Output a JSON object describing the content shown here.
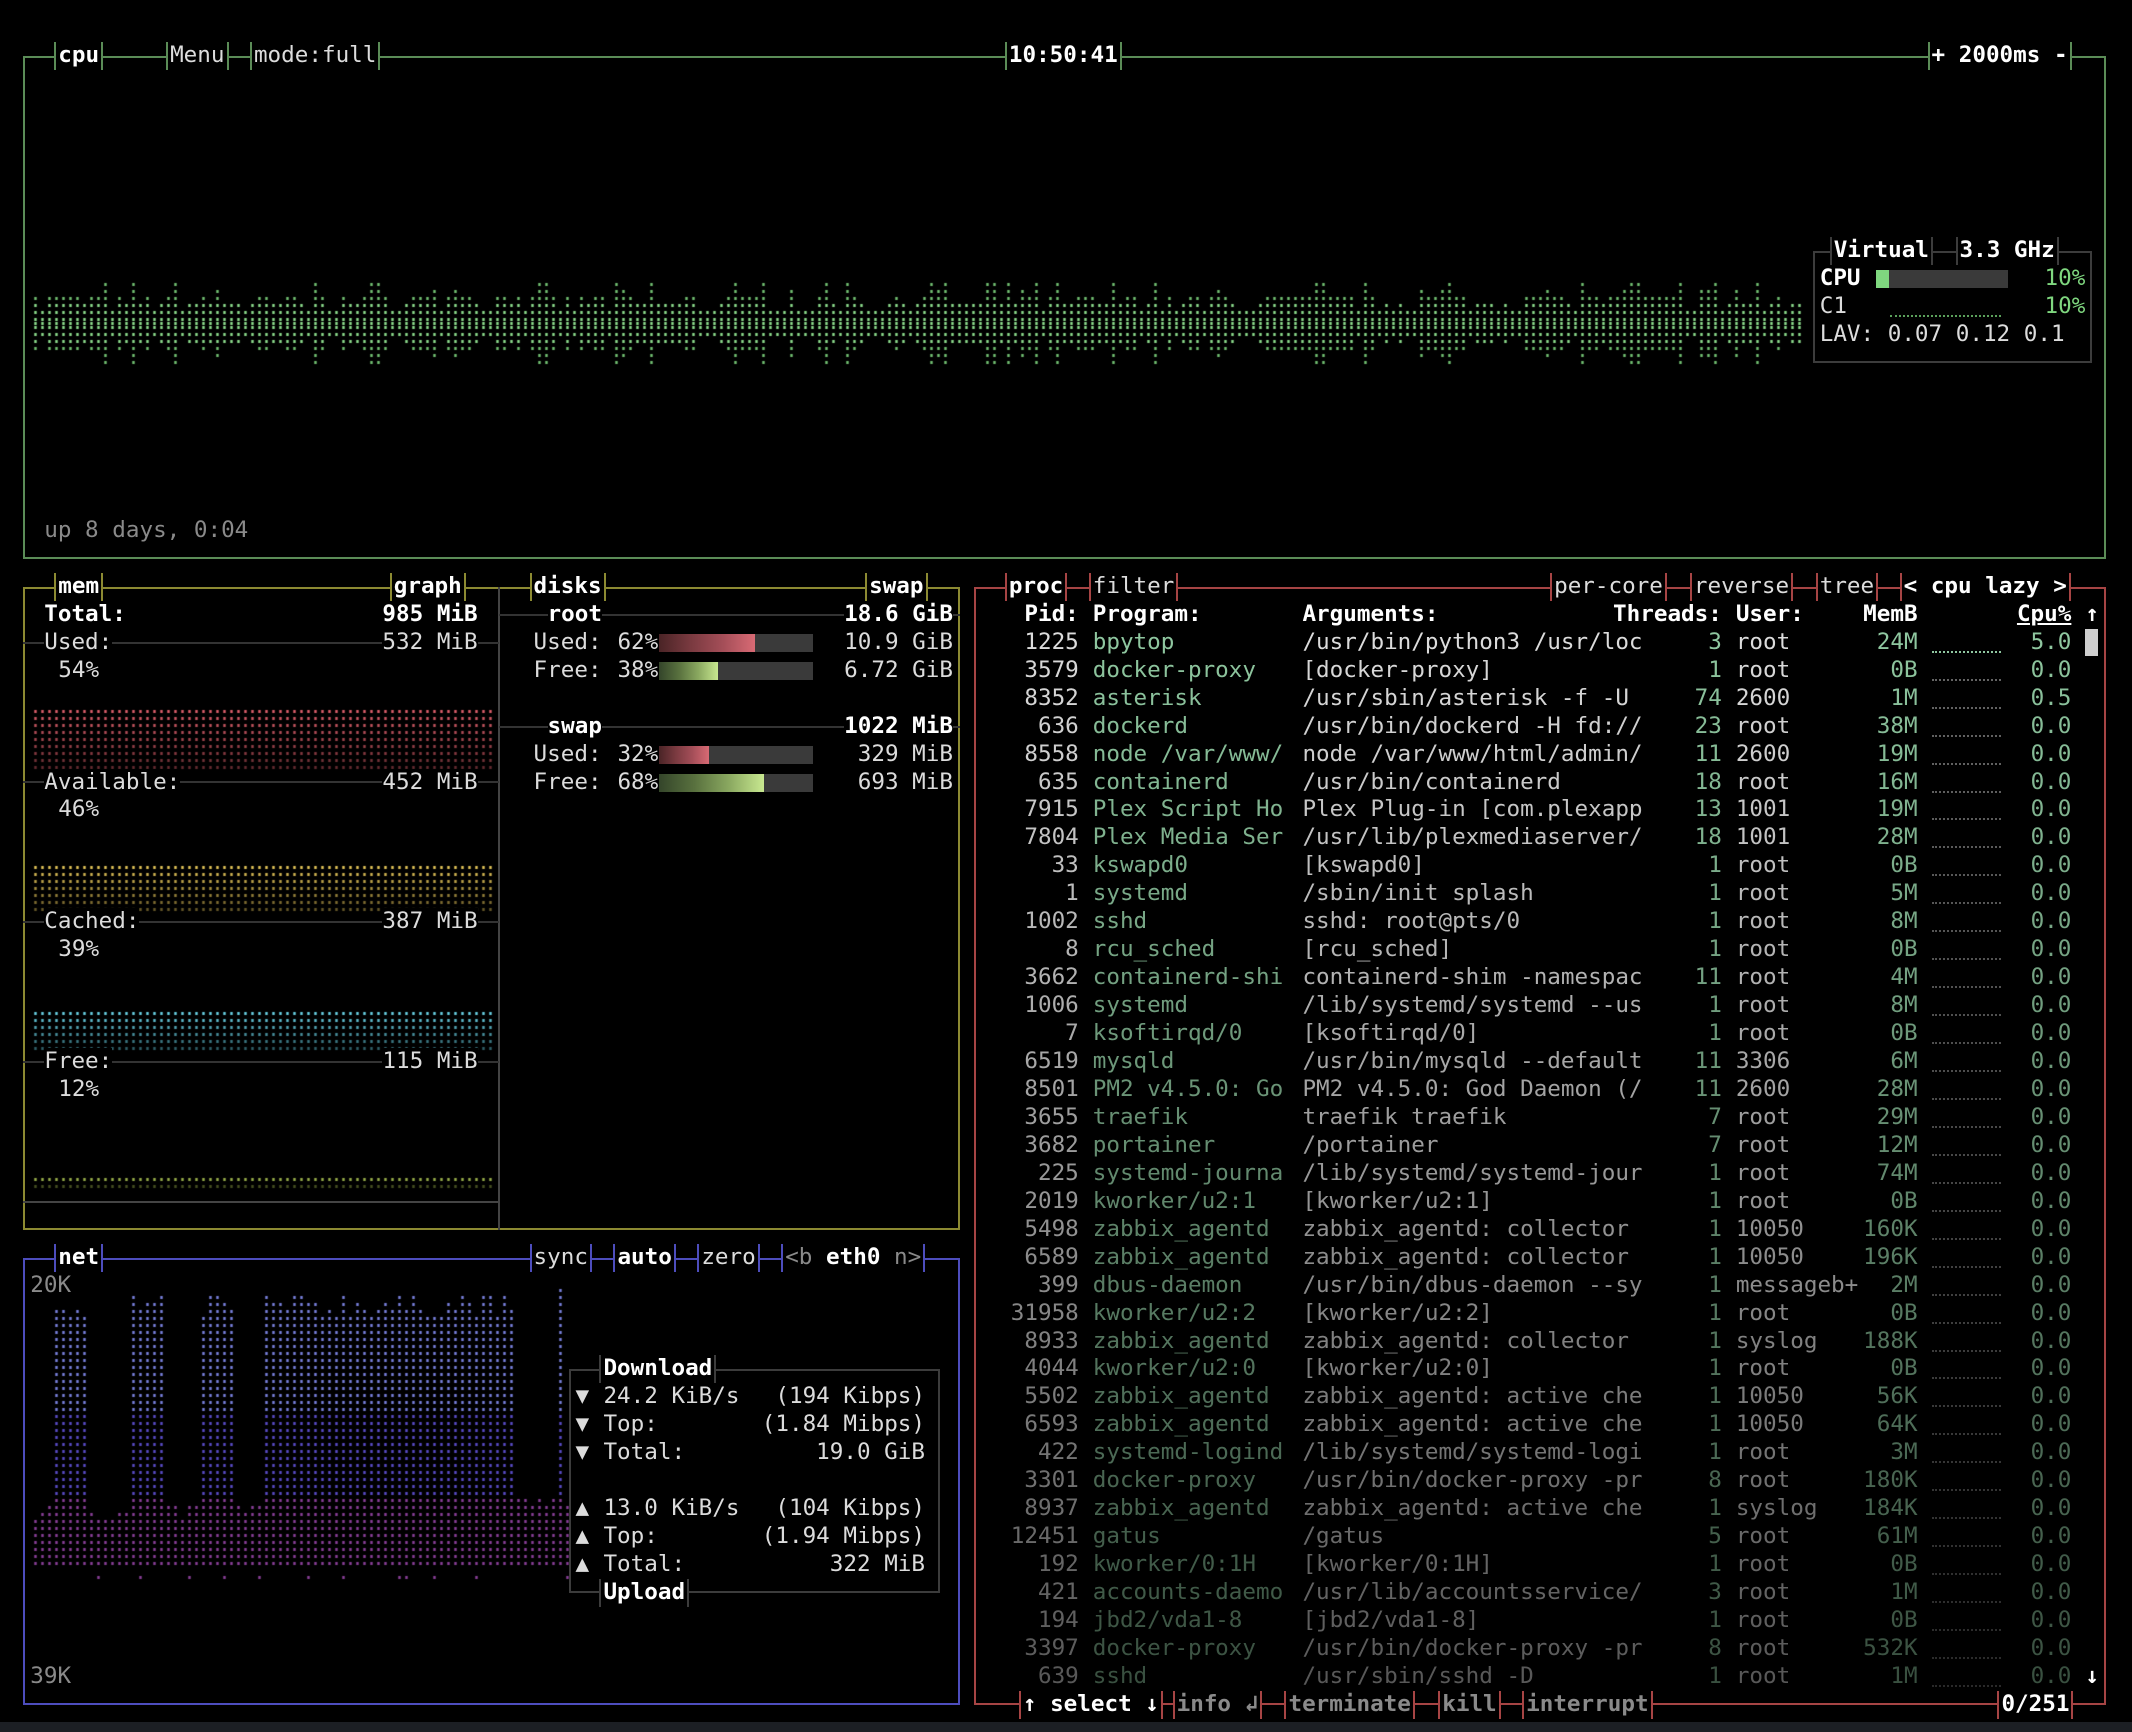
{
  "cpu": {
    "title": "cpu",
    "menu": "Menu",
    "mode": "mode:full",
    "clock": "10:50:41",
    "interval": "+ 2000ms -",
    "uptime": "up 8 days, 0:04",
    "info": {
      "name": "Virtual",
      "freq": "3.3 GHz",
      "cpu_label": "CPU",
      "cpu_pct": "10%",
      "core_label": "C1",
      "core_pct": "10%",
      "lav": "LAV: 0.07 0.12 0.1"
    }
  },
  "mem": {
    "title": "mem",
    "graph_toggle": "graph",
    "total_label": "Total:",
    "total": "985 MiB",
    "items": [
      {
        "label": "Used:",
        "value": "532 MiB",
        "pct": "54%",
        "color": "#e0606c"
      },
      {
        "label": "Available:",
        "value": "452 MiB",
        "pct": "46%",
        "color": "#e8c85a"
      },
      {
        "label": "Cached:",
        "value": "387 MiB",
        "pct": "39%",
        "color": "#6ad4e8"
      },
      {
        "label": "Free:",
        "value": "115 MiB",
        "pct": "12%",
        "color": "#9ab04a"
      }
    ]
  },
  "disks": {
    "title": "disks",
    "swap_toggle": "swap",
    "items": [
      {
        "name": "root",
        "size": "18.6 GiB",
        "used": {
          "label": "Used:",
          "pct": "62%",
          "value": "10.9 GiB"
        },
        "free": {
          "label": "Free:",
          "pct": "38%",
          "value": "6.72 GiB"
        }
      },
      {
        "name": "swap",
        "size": "1022 MiB",
        "used": {
          "label": "Used:",
          "pct": "32%",
          "value": "329 MiB"
        },
        "free": {
          "label": "Free:",
          "pct": "68%",
          "value": "693 MiB"
        }
      }
    ]
  },
  "net": {
    "title": "net",
    "sync": "sync",
    "auto": "auto",
    "zero": "zero",
    "iface_prev": "<b",
    "iface": "eth0",
    "iface_next": "n>",
    "scale_top": "20K",
    "scale_bottom": "39K",
    "download": {
      "title": "Download",
      "rate": "24.2 KiB/s",
      "rate_bits": "(194 Kibps)",
      "top_label": "Top:",
      "top": "(1.84 Mibps)",
      "total_label": "Total:",
      "total": "19.0 GiB",
      "arrow": "▼"
    },
    "upload": {
      "title": "Upload",
      "rate": "13.0 KiB/s",
      "rate_bits": "(104 Kibps)",
      "top_label": "Top:",
      "top": "(1.94 Mibps)",
      "total_label": "Total:",
      "total": "322 MiB",
      "arrow": "▲"
    }
  },
  "proc": {
    "title": "proc",
    "filter": "filter",
    "per_core": "per-core",
    "reverse": "reverse",
    "tree": "tree",
    "sort_prev": "<",
    "sort": "cpu lazy",
    "sort_next": ">",
    "columns": {
      "pid": "Pid:",
      "program": "Program:",
      "args": "Arguments:",
      "threads": "Threads:",
      "user": "User:",
      "mem": "MemB",
      "cpu": "Cpu%"
    },
    "scroll_up": "↑",
    "scroll_down": "↓",
    "rows": [
      {
        "pid": "1225",
        "program": "bpytop",
        "args": "/usr/bin/python3 /usr/loc",
        "threads": "3",
        "user": "root",
        "mem": "24M",
        "cpu": "5.0"
      },
      {
        "pid": "3579",
        "program": "docker-proxy",
        "args": "[docker-proxy]",
        "threads": "1",
        "user": "root",
        "mem": "0B",
        "cpu": "0.0"
      },
      {
        "pid": "8352",
        "program": "asterisk",
        "args": "/usr/sbin/asterisk -f -U",
        "threads": "74",
        "user": "2600",
        "mem": "1M",
        "cpu": "0.5"
      },
      {
        "pid": "636",
        "program": "dockerd",
        "args": "/usr/bin/dockerd -H fd://",
        "threads": "23",
        "user": "root",
        "mem": "38M",
        "cpu": "0.0"
      },
      {
        "pid": "8558",
        "program": "node /var/www/",
        "args": "node /var/www/html/admin/",
        "threads": "11",
        "user": "2600",
        "mem": "19M",
        "cpu": "0.0"
      },
      {
        "pid": "635",
        "program": "containerd",
        "args": "/usr/bin/containerd",
        "threads": "18",
        "user": "root",
        "mem": "16M",
        "cpu": "0.0"
      },
      {
        "pid": "7915",
        "program": "Plex Script Ho",
        "args": "Plex Plug-in [com.plexapp",
        "threads": "13",
        "user": "1001",
        "mem": "19M",
        "cpu": "0.0"
      },
      {
        "pid": "7804",
        "program": "Plex Media Ser",
        "args": "/usr/lib/plexmediaserver/",
        "threads": "18",
        "user": "1001",
        "mem": "28M",
        "cpu": "0.0"
      },
      {
        "pid": "33",
        "program": "kswapd0",
        "args": "[kswapd0]",
        "threads": "1",
        "user": "root",
        "mem": "0B",
        "cpu": "0.0"
      },
      {
        "pid": "1",
        "program": "systemd",
        "args": "/sbin/init splash",
        "threads": "1",
        "user": "root",
        "mem": "5M",
        "cpu": "0.0"
      },
      {
        "pid": "1002",
        "program": "sshd",
        "args": "sshd: root@pts/0",
        "threads": "1",
        "user": "root",
        "mem": "8M",
        "cpu": "0.0"
      },
      {
        "pid": "8",
        "program": "rcu_sched",
        "args": "[rcu_sched]",
        "threads": "1",
        "user": "root",
        "mem": "0B",
        "cpu": "0.0"
      },
      {
        "pid": "3662",
        "program": "containerd-shi",
        "args": "containerd-shim -namespac",
        "threads": "11",
        "user": "root",
        "mem": "4M",
        "cpu": "0.0"
      },
      {
        "pid": "1006",
        "program": "systemd",
        "args": "/lib/systemd/systemd --us",
        "threads": "1",
        "user": "root",
        "mem": "8M",
        "cpu": "0.0"
      },
      {
        "pid": "7",
        "program": "ksoftirqd/0",
        "args": "[ksoftirqd/0]",
        "threads": "1",
        "user": "root",
        "mem": "0B",
        "cpu": "0.0"
      },
      {
        "pid": "6519",
        "program": "mysqld",
        "args": "/usr/bin/mysqld --default",
        "threads": "11",
        "user": "3306",
        "mem": "6M",
        "cpu": "0.0"
      },
      {
        "pid": "8501",
        "program": "PM2 v4.5.0: Go",
        "args": "PM2 v4.5.0: God Daemon (/",
        "threads": "11",
        "user": "2600",
        "mem": "28M",
        "cpu": "0.0"
      },
      {
        "pid": "3655",
        "program": "traefik",
        "args": "traefik traefik",
        "threads": "7",
        "user": "root",
        "mem": "29M",
        "cpu": "0.0"
      },
      {
        "pid": "3682",
        "program": "portainer",
        "args": "/portainer",
        "threads": "7",
        "user": "root",
        "mem": "12M",
        "cpu": "0.0"
      },
      {
        "pid": "225",
        "program": "systemd-journa",
        "args": "/lib/systemd/systemd-jour",
        "threads": "1",
        "user": "root",
        "mem": "74M",
        "cpu": "0.0"
      },
      {
        "pid": "2019",
        "program": "kworker/u2:1",
        "args": "[kworker/u2:1]",
        "threads": "1",
        "user": "root",
        "mem": "0B",
        "cpu": "0.0"
      },
      {
        "pid": "5498",
        "program": "zabbix_agentd",
        "args": "zabbix_agentd: collector",
        "threads": "1",
        "user": "10050",
        "mem": "160K",
        "cpu": "0.0"
      },
      {
        "pid": "6589",
        "program": "zabbix_agentd",
        "args": "zabbix_agentd: collector",
        "threads": "1",
        "user": "10050",
        "mem": "196K",
        "cpu": "0.0"
      },
      {
        "pid": "399",
        "program": "dbus-daemon",
        "args": "/usr/bin/dbus-daemon --sy",
        "threads": "1",
        "user": "messageb+",
        "mem": "2M",
        "cpu": "0.0"
      },
      {
        "pid": "31958",
        "program": "kworker/u2:2",
        "args": "[kworker/u2:2]",
        "threads": "1",
        "user": "root",
        "mem": "0B",
        "cpu": "0.0"
      },
      {
        "pid": "8933",
        "program": "zabbix_agentd",
        "args": "zabbix_agentd: collector",
        "threads": "1",
        "user": "syslog",
        "mem": "188K",
        "cpu": "0.0"
      },
      {
        "pid": "4044",
        "program": "kworker/u2:0",
        "args": "[kworker/u2:0]",
        "threads": "1",
        "user": "root",
        "mem": "0B",
        "cpu": "0.0"
      },
      {
        "pid": "5502",
        "program": "zabbix_agentd",
        "args": "zabbix_agentd: active che",
        "threads": "1",
        "user": "10050",
        "mem": "56K",
        "cpu": "0.0"
      },
      {
        "pid": "6593",
        "program": "zabbix_agentd",
        "args": "zabbix_agentd: active che",
        "threads": "1",
        "user": "10050",
        "mem": "64K",
        "cpu": "0.0"
      },
      {
        "pid": "422",
        "program": "systemd-logind",
        "args": "/lib/systemd/systemd-logi",
        "threads": "1",
        "user": "root",
        "mem": "3M",
        "cpu": "0.0"
      },
      {
        "pid": "3301",
        "program": "docker-proxy",
        "args": "/usr/bin/docker-proxy -pr",
        "threads": "8",
        "user": "root",
        "mem": "180K",
        "cpu": "0.0"
      },
      {
        "pid": "8937",
        "program": "zabbix_agentd",
        "args": "zabbix_agentd: active che",
        "threads": "1",
        "user": "syslog",
        "mem": "184K",
        "cpu": "0.0"
      },
      {
        "pid": "12451",
        "program": "gatus",
        "args": "/gatus",
        "threads": "5",
        "user": "root",
        "mem": "61M",
        "cpu": "0.0"
      },
      {
        "pid": "192",
        "program": "kworker/0:1H",
        "args": "[kworker/0:1H]",
        "threads": "1",
        "user": "root",
        "mem": "0B",
        "cpu": "0.0"
      },
      {
        "pid": "421",
        "program": "accounts-daemo",
        "args": "/usr/lib/accountsservice/",
        "threads": "3",
        "user": "root",
        "mem": "1M",
        "cpu": "0.0"
      },
      {
        "pid": "194",
        "program": "jbd2/vda1-8",
        "args": "[jbd2/vda1-8]",
        "threads": "1",
        "user": "root",
        "mem": "0B",
        "cpu": "0.0"
      },
      {
        "pid": "3397",
        "program": "docker-proxy",
        "args": "/usr/bin/docker-proxy -pr",
        "threads": "8",
        "user": "root",
        "mem": "532K",
        "cpu": "0.0"
      },
      {
        "pid": "639",
        "program": "sshd",
        "args": "/usr/sbin/sshd -D",
        "threads": "1",
        "user": "root",
        "mem": "1M",
        "cpu": "0.0"
      }
    ],
    "footer": {
      "select": "↑ select ↓",
      "info": "info ↲",
      "terminate": "terminate",
      "kill": "kill",
      "interrupt": "interrupt",
      "count": "0/251"
    }
  },
  "colors": {
    "cpu_border": "#5b8c57",
    "mem_border": "#8c8a32",
    "net_border": "#4d4dbd",
    "proc_border": "#a64444",
    "cpu_graph": "#8ee08e"
  }
}
